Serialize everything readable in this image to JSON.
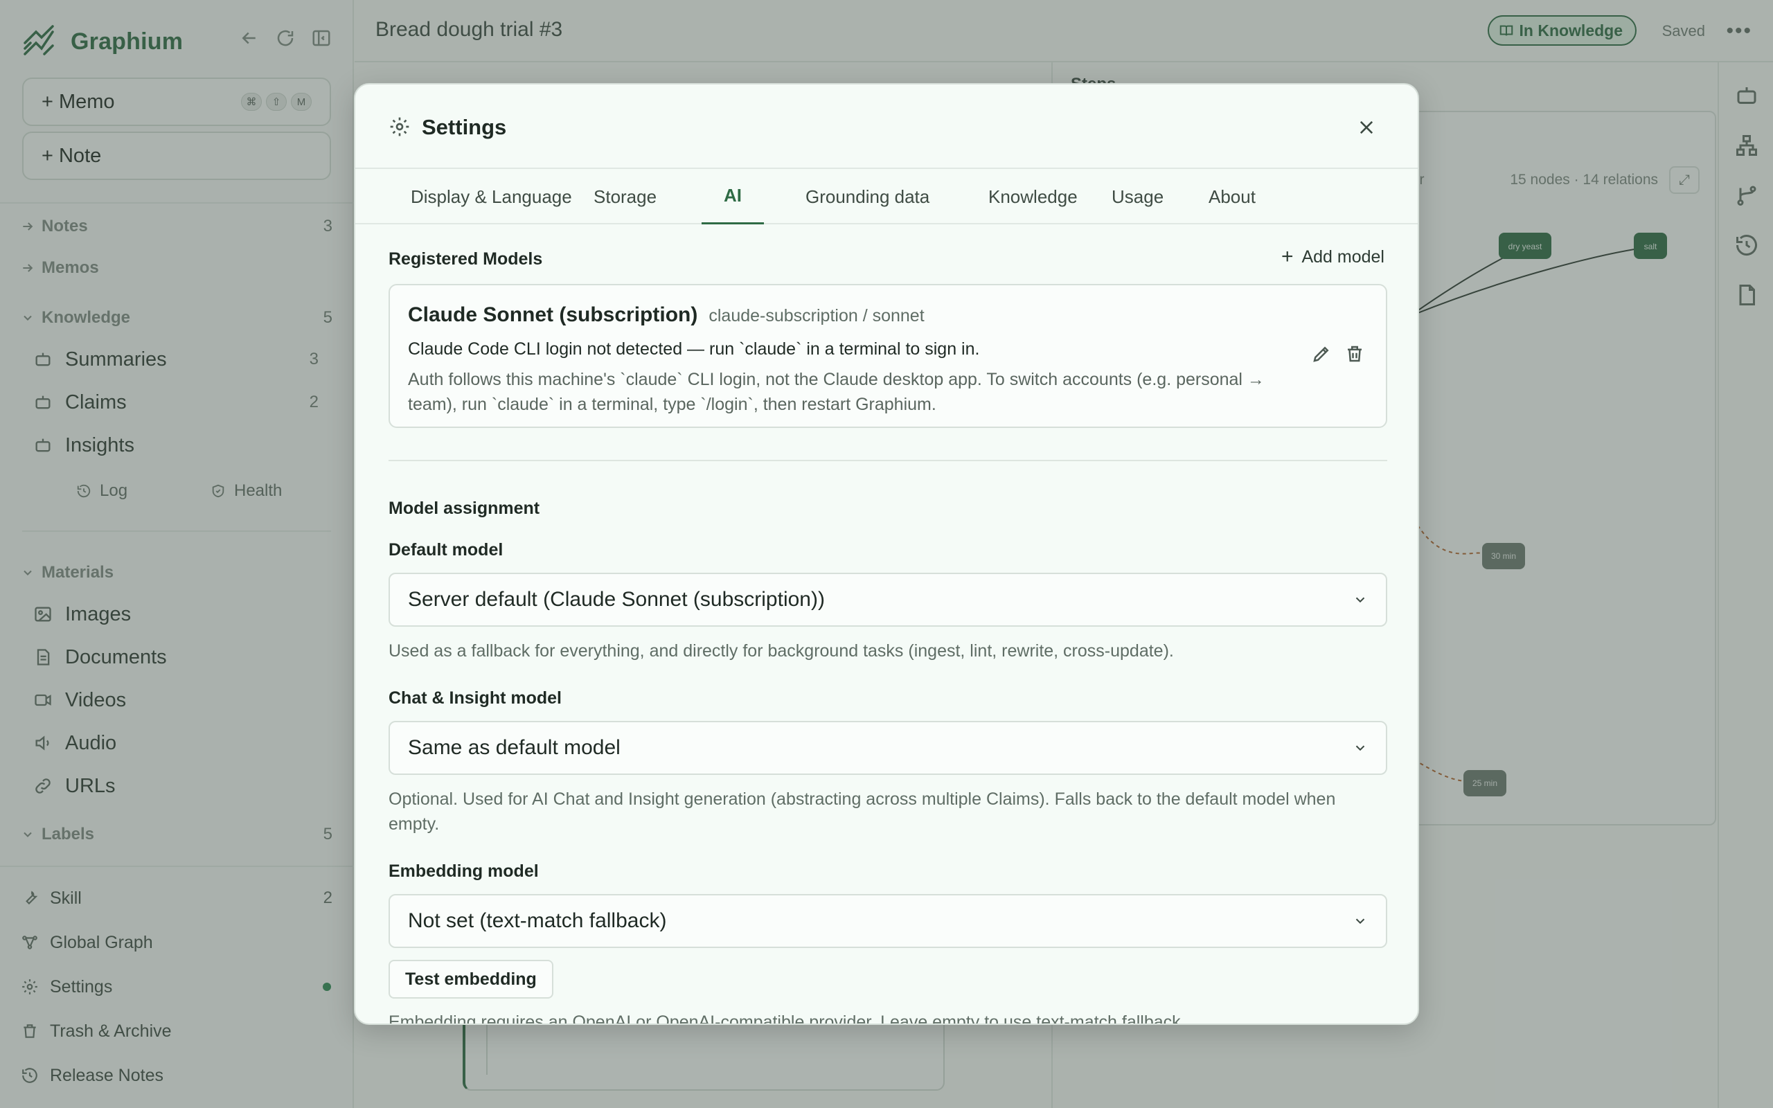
{
  "app": {
    "name": "Graphium"
  },
  "sidebar": {
    "memo_label": "+ Memo",
    "memo_shortcut": [
      "⌘",
      "⇧",
      "M"
    ],
    "note_label": "+ Note",
    "notes": {
      "label": "Notes",
      "count": "3"
    },
    "memos": {
      "label": "Memos"
    },
    "knowledge": {
      "label": "Knowledge",
      "count": "5"
    },
    "knowledge_items": [
      {
        "label": "Summaries",
        "count": "3"
      },
      {
        "label": "Claims",
        "count": "2"
      },
      {
        "label": "Insights"
      }
    ],
    "log_label": "Log",
    "health_label": "Health",
    "materials": {
      "label": "Materials"
    },
    "material_items": [
      "Images",
      "Documents",
      "Videos",
      "Audio",
      "URLs"
    ],
    "labels": {
      "label": "Labels",
      "count": "5"
    },
    "footer": [
      {
        "label": "Skill",
        "count": "2"
      },
      {
        "label": "Global Graph"
      },
      {
        "label": "Settings"
      },
      {
        "label": "Trash & Archive"
      },
      {
        "label": "Release Notes"
      }
    ]
  },
  "topbar": {
    "doc_title": "Bread dough trial #3",
    "badge": "In Knowledge",
    "saved": "Saved"
  },
  "steps_label": "Steps",
  "graph": {
    "meta": "15 nodes · 14 relations",
    "filter_fragment": "ter",
    "nodes": [
      "dry yeast",
      "salt",
      "30 min",
      "25 min"
    ]
  },
  "settings": {
    "title": "Settings",
    "tabs": [
      "Display & Language",
      "Storage",
      "AI",
      "Grounding data",
      "Knowledge",
      "Usage",
      "About"
    ],
    "active_tab": "AI",
    "registered_models_heading": "Registered Models",
    "add_model": "Add model",
    "model": {
      "name": "Claude Sonnet (subscription)",
      "id": "claude-subscription / sonnet",
      "warning": "Claude Code CLI login not detected — run `claude` in a terminal to sign in.",
      "note": "Auth follows this machine's `claude` CLI login, not the Claude desktop app. To switch accounts (e.g. personal → team), run `claude` in a terminal, type `/login`, then restart Graphium."
    },
    "assignment_heading": "Model assignment",
    "default_model": {
      "label": "Default model",
      "value": "Server default (Claude Sonnet (subscription))",
      "help": "Used as a fallback for everything, and directly for background tasks (ingest, lint, rewrite, cross-update)."
    },
    "chat_model": {
      "label": "Chat & Insight model",
      "value": "Same as default model",
      "help": "Optional. Used for AI Chat and Insight generation (abstracting across multiple Claims). Falls back to the default model when empty."
    },
    "embedding_model": {
      "label": "Embedding model",
      "value": "Not set (text-match fallback)",
      "test_button": "Test embedding",
      "help": "Embedding requires an OpenAI or OpenAI-compatible provider. Leave empty to use text-match fallback."
    }
  },
  "colors": {
    "accent": "#2f6b45",
    "node_green": "#2f6b45",
    "node_gray": "#6c7a71",
    "node_red": "#c0453d"
  }
}
